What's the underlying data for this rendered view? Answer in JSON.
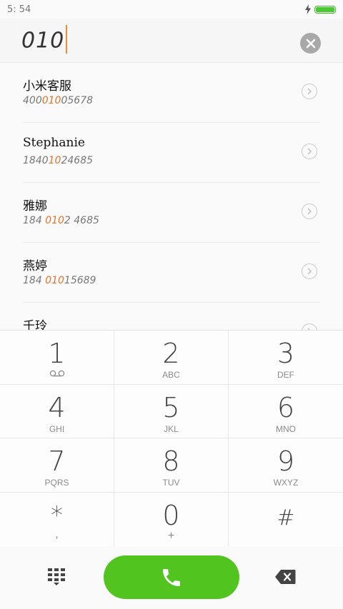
{
  "status_bar": {
    "time": "5: 54"
  },
  "dialer": {
    "input_value": "010"
  },
  "contacts": [
    {
      "name": "小米客服",
      "number_before": "400",
      "number_match": "010",
      "number_after": "05678"
    },
    {
      "name": "Stephanie",
      "number_before": "1840",
      "number_match": "10",
      "number_after": "24685"
    },
    {
      "name": "雅娜",
      "number_before": "184 ",
      "number_match": "010",
      "number_after": "2 4685"
    },
    {
      "name": "燕婷",
      "number_before": "184 ",
      "number_match": "010",
      "number_after": "15689"
    },
    {
      "name": "千玲",
      "number_before": "",
      "number_match": "",
      "number_after": ""
    }
  ],
  "keypad": [
    {
      "digit": "1",
      "letters": ""
    },
    {
      "digit": "2",
      "letters": "ABC"
    },
    {
      "digit": "3",
      "letters": "DEF"
    },
    {
      "digit": "4",
      "letters": "GHI"
    },
    {
      "digit": "5",
      "letters": "JKL"
    },
    {
      "digit": "6",
      "letters": "MNO"
    },
    {
      "digit": "7",
      "letters": "PQRS"
    },
    {
      "digit": "8",
      "letters": "TUV"
    },
    {
      "digit": "9",
      "letters": "WXYZ"
    },
    {
      "digit": "*",
      "letters": ","
    },
    {
      "digit": "0",
      "letters": "+"
    },
    {
      "digit": "#",
      "letters": ""
    }
  ],
  "colors": {
    "accent": "#e8732a",
    "call_green": "#52c41f",
    "battery_green": "#4cc734"
  },
  "icons": {
    "charging": "lightning-icon",
    "battery": "battery-icon",
    "clear": "close-icon",
    "chevron": "chevron-right-icon",
    "voicemail": "voicemail-icon",
    "dialpad": "dialpad-icon",
    "call": "phone-icon",
    "delete": "backspace-icon"
  }
}
